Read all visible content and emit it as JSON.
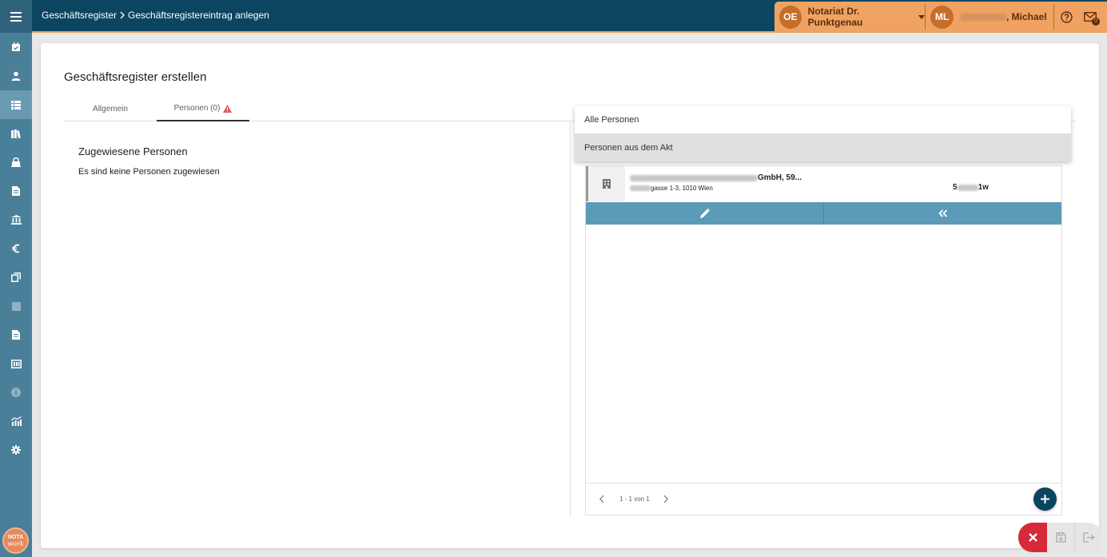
{
  "breadcrumb": {
    "parent": "Geschäftsregister",
    "current": "Geschäftsregistereintrag anlegen"
  },
  "header": {
    "org_initials": "OE",
    "org_name": "Notariat Dr. Punktgenau",
    "user_initials": "ML",
    "user_name_suffix": ", Michael",
    "mail_badge": "0"
  },
  "page": {
    "title": "Geschäftsregister erstellen",
    "tabs": [
      {
        "label": "Allgemein"
      },
      {
        "label": "Personen (0)"
      }
    ],
    "section_title": "Zugewiesene Personen",
    "empty_text": "Es sind keine Personen zugewiesen"
  },
  "dropdown": {
    "items": [
      {
        "label": "Alle Personen"
      },
      {
        "label": "Personen aus dem Akt"
      }
    ]
  },
  "person": {
    "name_suffix": "GmbH, 59...",
    "address_suffix": "gasse 1-3, 1010 Wien",
    "id_prefix": "5",
    "id_suffix": "1w"
  },
  "pager": {
    "info": "1 - 1 von 1"
  },
  "logo": {
    "top": "NOTA",
    "bottom": "work"
  },
  "icons": {
    "menu": "menu-icon",
    "tab_warning": "warning-icon",
    "person_type": "building-icon",
    "edit": "pencil-icon",
    "assign": "double-chevron-left-icon",
    "add": "plus-icon",
    "cancel": "close-icon",
    "save": "floppy-icon",
    "exit": "exit-icon"
  },
  "colors": {
    "topbar": "#0b4560",
    "sidebar": "#4a7f9a",
    "user_area": "#f0a262",
    "action_bar": "#5b9bb8",
    "cancel": "#d62a3a",
    "warning": "#e05a5a"
  }
}
